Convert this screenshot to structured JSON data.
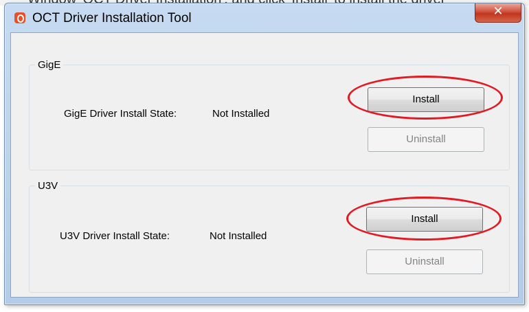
{
  "window": {
    "title": "OCT Driver Installation Tool",
    "close_glyph": "✕"
  },
  "top_strip": {
    "text": "Window 'OCT Driver Installation', and click 'Install' to install the driver"
  },
  "groups": [
    {
      "legend": "GigE",
      "state_label": "GigE Driver Install State:",
      "state_value": "Not Installed",
      "install_label": "Install",
      "uninstall_label": "Uninstall",
      "uninstall_enabled": false,
      "install_highlighted": true
    },
    {
      "legend": "U3V",
      "state_label": "U3V Driver Install State:",
      "state_value": "Not Installed",
      "install_label": "Install",
      "uninstall_label": "Uninstall",
      "uninstall_enabled": false,
      "install_highlighted": true
    }
  ],
  "colors": {
    "highlight": "#e01b24",
    "close_button": "#c0361f",
    "app_icon": "#e8502a",
    "dialog_background": "#f0f0f0"
  },
  "icons": {
    "app": "app-logo-icon",
    "close": "close-icon"
  }
}
